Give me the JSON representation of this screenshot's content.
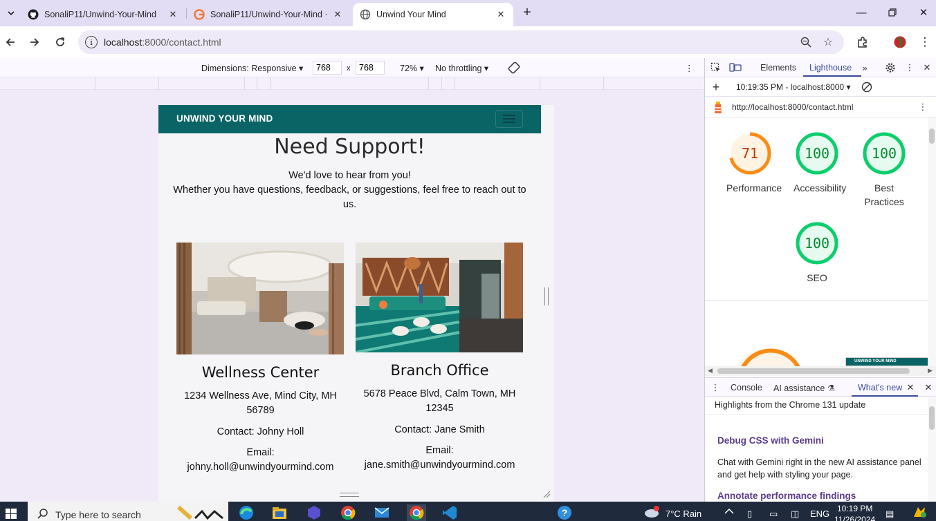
{
  "browser": {
    "tabs": [
      {
        "title": "SonaliP11/Unwind-Your-Mind",
        "icon": "github-icon",
        "active": false
      },
      {
        "title": "SonaliP11/Unwind-Your-Mind ·",
        "icon": "git-icon",
        "active": false
      },
      {
        "title": "Unwind Your Mind",
        "icon": "globe-icon",
        "active": true
      }
    ],
    "url_host": "localhost",
    "url_path": ":8000/contact.html"
  },
  "device_toolbar": {
    "dimensions_label": "Dimensions: Responsive",
    "width": "768",
    "height": "768",
    "times": "x",
    "zoom": "72%",
    "throttling": "No throttling"
  },
  "site": {
    "brand": "UNWIND YOUR MIND",
    "heading": "Need Support!",
    "intro_line1": "We'd love to hear from you!",
    "intro_line2": "Whether you have questions, feedback, or suggestions, feel free to reach out to us.",
    "cards": [
      {
        "title": "Wellness Center",
        "address": "1234 Wellness Ave, Mind City, MH 56789",
        "contact": "Contact: Johny Holl",
        "email_label": "Email:",
        "email": "johny.holl@unwindyourmind.com"
      },
      {
        "title": "Branch Office",
        "address": "5678 Peace Blvd, Calm Town, MH 12345",
        "contact": "Contact: Jane Smith",
        "email_label": "Email:",
        "email": "jane.smith@unwindyourmind.com"
      }
    ]
  },
  "devtools": {
    "tabs": {
      "elements": "Elements",
      "lighthouse": "Lighthouse"
    },
    "report_time": "10:19:35 PM - localhost:8000",
    "report_url": "http://localhost:8000/contact.html",
    "scores": [
      {
        "label": "Performance",
        "value": "71",
        "score": 0.71,
        "color": "#fa8c16"
      },
      {
        "label": "Accessibility",
        "value": "100",
        "score": 1.0,
        "color": "#0cce6b"
      },
      {
        "label": "Best Practices",
        "value": "100",
        "score": 1.0,
        "color": "#0cce6b"
      },
      {
        "label": "SEO",
        "value": "100",
        "score": 1.0,
        "color": "#0cce6b"
      }
    ],
    "thumb_text": "UNWIND YOUR MIND",
    "drawer_tabs": {
      "console": "Console",
      "ai": "AI assistance",
      "whats_new": "What's new"
    },
    "drawer": {
      "highlights": "Highlights from the Chrome 131 update",
      "h1": "Debug CSS with Gemini",
      "p1": "Chat with Gemini right in the new AI assistance panel and get help with styling your page.",
      "h2": "Annotate performance findings"
    }
  },
  "taskbar": {
    "search_placeholder": "Type here to search",
    "weather": "7°C  Rain",
    "lang": "ENG",
    "time": "10:19 PM",
    "date": "11/26/2024"
  }
}
